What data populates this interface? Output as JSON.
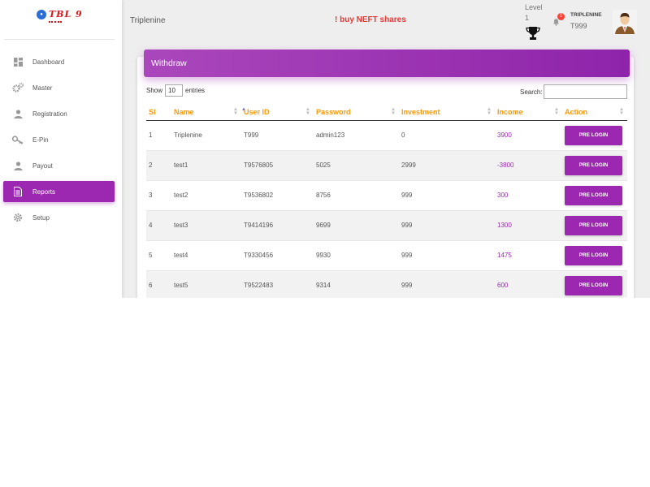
{
  "brand": {
    "logo_text": "TBL 9",
    "name": "Triplenine"
  },
  "alert": "! buy NEFT shares",
  "level": {
    "label": "Level",
    "value": "1"
  },
  "notifications": {
    "count": "0"
  },
  "user": {
    "name": "TRIPLENINE",
    "id": "T999"
  },
  "sidebar": {
    "items": [
      {
        "label": "Dashboard",
        "icon": "dashboard-icon"
      },
      {
        "label": "Master",
        "icon": "gears-icon"
      },
      {
        "label": "Registration",
        "icon": "person-icon"
      },
      {
        "label": "E-Pin",
        "icon": "key-icon"
      },
      {
        "label": "Payout",
        "icon": "person-icon"
      },
      {
        "label": "Reports",
        "icon": "document-icon",
        "active": true
      },
      {
        "label": "Setup",
        "icon": "gear-icon"
      }
    ]
  },
  "card": {
    "title": "Withdraw"
  },
  "table_controls": {
    "show_label": "Show",
    "entries_value": "10",
    "entries_label": "entries",
    "search_label": "Search:",
    "search_value": ""
  },
  "table": {
    "headers": [
      "Sl",
      "Name",
      "User ID",
      "Password",
      "Investment",
      "Income",
      "Action"
    ],
    "rows": [
      {
        "sl": "1",
        "name": "Triplenine",
        "user_id": "T999",
        "password": "admin123",
        "investment": "0",
        "income": "3900",
        "action": "PRE LOGIN"
      },
      {
        "sl": "2",
        "name": "test1",
        "user_id": "T9576805",
        "password": "5025",
        "investment": "2999",
        "income": "-3800",
        "action": "PRE LOGIN"
      },
      {
        "sl": "3",
        "name": "test2",
        "user_id": "T9536802",
        "password": "8756",
        "investment": "999",
        "income": "300",
        "action": "PRE LOGIN"
      },
      {
        "sl": "4",
        "name": "test3",
        "user_id": "T9414196",
        "password": "9699",
        "investment": "999",
        "income": "1300",
        "action": "PRE LOGIN"
      },
      {
        "sl": "5",
        "name": "test4",
        "user_id": "T9330456",
        "password": "9930",
        "investment": "999",
        "income": "1475",
        "action": "PRE LOGIN"
      },
      {
        "sl": "6",
        "name": "test5",
        "user_id": "T9522483",
        "password": "9314",
        "investment": "999",
        "income": "600",
        "action": "PRE LOGIN"
      }
    ]
  },
  "colors": {
    "accent": "#9c27b0",
    "header_text": "#ff9800",
    "alert": "#e53935"
  }
}
